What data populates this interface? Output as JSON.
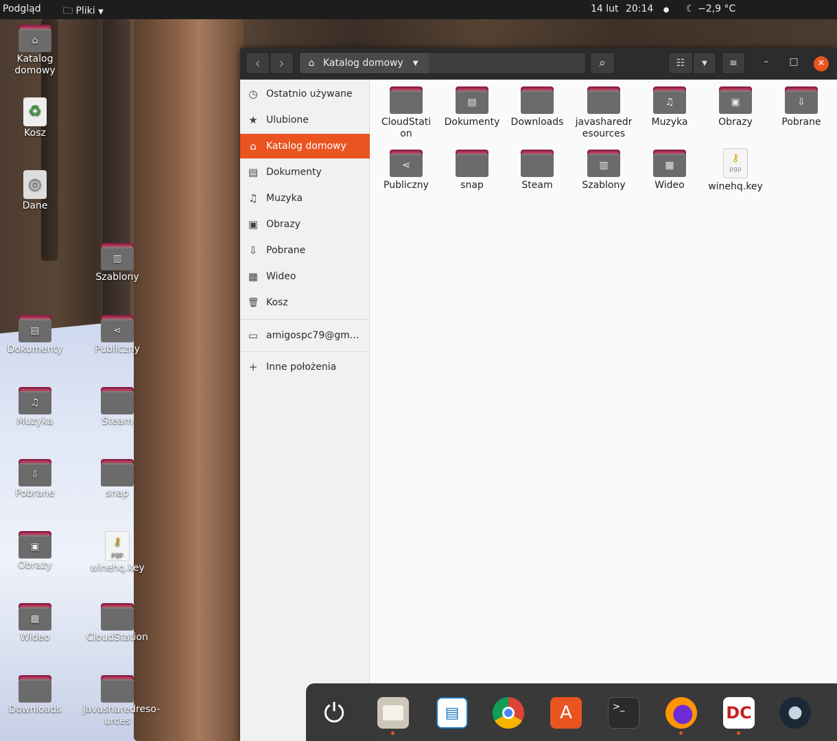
{
  "topbar": {
    "app_label": "Podgląd",
    "files_menu": "Pliki",
    "date": "14 lut",
    "time": "20:14",
    "weather": "−2,9 °C"
  },
  "desktop": {
    "icons": [
      {
        "label": "Katalog\ndomowy",
        "glyph": "⌂"
      },
      {
        "label": "Kosz",
        "glyph": "♻"
      },
      {
        "label": "Dane",
        "glyph": "◎"
      },
      {
        "label": "Szablony",
        "glyph": "▥"
      },
      {
        "label": "Dokumenty",
        "glyph": "▤"
      },
      {
        "label": "Publiczny",
        "glyph": "⋖"
      },
      {
        "label": "Muzyka",
        "glyph": "♫"
      },
      {
        "label": "Steam",
        "glyph": ""
      },
      {
        "label": "Pobrane",
        "glyph": "⇩"
      },
      {
        "label": "snap",
        "glyph": ""
      },
      {
        "label": "Obrazy",
        "glyph": "▣"
      },
      {
        "label": "winehq.key",
        "glyph": "pgp"
      },
      {
        "label": "Wideo",
        "glyph": "▦"
      },
      {
        "label": "CloudStation",
        "glyph": ""
      },
      {
        "label": "Downloads",
        "glyph": ""
      },
      {
        "label": "javasharedreso-\nurces",
        "glyph": ""
      }
    ]
  },
  "window": {
    "path_label": "Katalog domowy",
    "back_icon": "‹",
    "forward_icon": "›",
    "search_icon": "⌕",
    "view_icon": "☷",
    "view_dropdown_icon": "▼",
    "menu_icon": "≡",
    "minimize_icon": "–",
    "maximize_icon": "□",
    "close_icon": "✕"
  },
  "sidebar": {
    "items": [
      {
        "label": "Ostatnio używane",
        "icon": "◷"
      },
      {
        "label": "Ulubione",
        "icon": "★"
      },
      {
        "label": "Katalog domowy",
        "icon": "⌂"
      },
      {
        "label": "Dokumenty",
        "icon": "▤"
      },
      {
        "label": "Muzyka",
        "icon": "♫"
      },
      {
        "label": "Obrazy",
        "icon": "▣"
      },
      {
        "label": "Pobrane",
        "icon": "⇩"
      },
      {
        "label": "Wideo",
        "icon": "▦"
      },
      {
        "label": "Kosz",
        "icon": "🗑"
      },
      {
        "label": "amigospc79@gm…",
        "icon": "▭"
      },
      {
        "label": "Inne położenia",
        "icon": "+"
      }
    ]
  },
  "content": {
    "items": [
      {
        "label": "CloudStati\non",
        "glyph": ""
      },
      {
        "label": "Dokumenty",
        "glyph": "▤"
      },
      {
        "label": "Downloads",
        "glyph": ""
      },
      {
        "label": "javasharedr\nesources",
        "glyph": ""
      },
      {
        "label": "Muzyka",
        "glyph": "♫"
      },
      {
        "label": "Obrazy",
        "glyph": "▣"
      },
      {
        "label": "Pobrane",
        "glyph": "⇩"
      },
      {
        "label": "Publiczny",
        "glyph": "⋖"
      },
      {
        "label": "snap",
        "glyph": ""
      },
      {
        "label": "Steam",
        "glyph": ""
      },
      {
        "label": "Szablony",
        "glyph": "▥"
      },
      {
        "label": "Wideo",
        "glyph": "▦"
      },
      {
        "label": "winehq.key",
        "glyph": "pgp"
      }
    ]
  },
  "dock": {
    "apps": [
      "power",
      "files",
      "writer",
      "chrome",
      "software",
      "terminal",
      "firefox",
      "dc",
      "steam"
    ],
    "terminal_prompt": ">_",
    "colors": {
      "accent": "#e95420",
      "folder_tab": "#8c2347",
      "folder_body": "#6b6b6b"
    }
  }
}
